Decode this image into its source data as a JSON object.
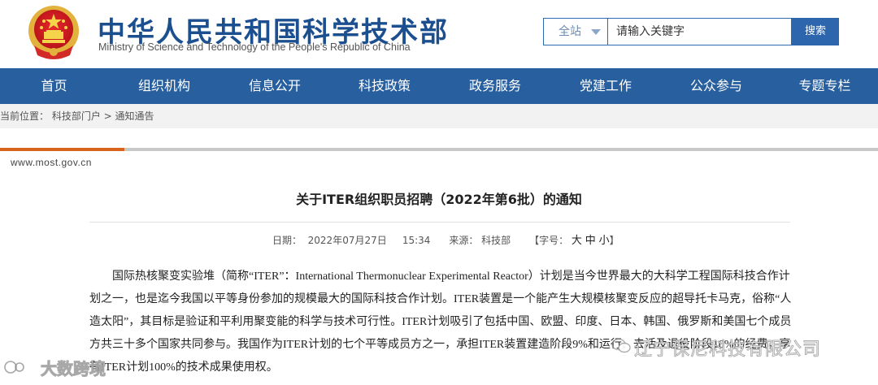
{
  "header": {
    "title_cn": "中华人民共和国科学技术部",
    "title_en": "Ministry of Science and Technology of the People's Republic of China",
    "emblem": "national-emblem-icon",
    "colors": {
      "brand": "#1b4f8f",
      "nav": "#285f9e",
      "accent_orange": "#d8631c"
    }
  },
  "search": {
    "scope": "全站",
    "placeholder": "请输入关键字",
    "button": "搜索"
  },
  "nav": {
    "items": [
      "首页",
      "组织机构",
      "信息公开",
      "科技政策",
      "政务服务",
      "党建工作",
      "公众参与",
      "专题专栏"
    ]
  },
  "breadcrumb": {
    "prefix": "当前位置：",
    "path": "科技部门户 > 通知通告"
  },
  "site_url": "www.most.gov.cn",
  "article": {
    "title": "关于ITER组织职员招聘（2022年第6批）的通知",
    "date_label": "日期：",
    "date": "2022年07月27日",
    "time": "15:34",
    "source_label": "来源：",
    "source": "科技部",
    "font_size_label": "【字号：",
    "font_sizes": [
      "大",
      "中",
      "小"
    ],
    "font_size_close": "】",
    "body": "国际热核聚变实验堆（简称“ITER”：International Thermonuclear Experimental Reactor）计划是当今世界最大的大科学工程国际科技合作计划之一，也是迄今我国以平等身份参加的规模最大的国际科技合作计划。ITER装置是一个能产生大规模核聚变反应的超导托卡马克，俗称“人造太阳”，其目标是验证和平利用聚变能的科学与技术可行性。ITER计划吸引了包括中国、欧盟、印度、日本、韩国、俄罗斯和美国七个成员方共三十多个国家共同参与。我国作为ITER计划的七个平等成员方之一，承担ITER装置建造阶段9%和运行、去活及退役阶段10%的经费，享有ITER计划100%的技术成果使用权。"
  },
  "watermarks": {
    "right": "辽宁保尼科技有限公司",
    "left": "大数跨境"
  }
}
